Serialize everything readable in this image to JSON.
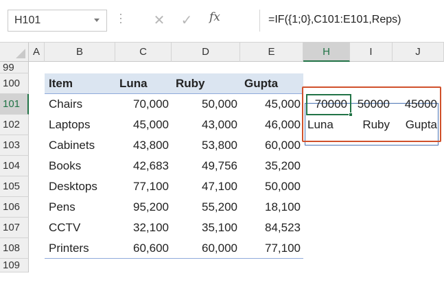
{
  "name_box": "H101",
  "formula_bar": {
    "cancel_icon": "✕",
    "enter_icon": "✓",
    "fx_label": "fx",
    "formula": "=IF({1;0},C101:E101,Reps)"
  },
  "columns": [
    "A",
    "B",
    "C",
    "D",
    "E",
    "H",
    "I",
    "J"
  ],
  "rows": [
    "99",
    "100",
    "101",
    "102",
    "103",
    "104",
    "105",
    "106",
    "107",
    "108",
    "109"
  ],
  "table": {
    "headers": [
      "Item",
      "Luna",
      "Ruby",
      "Gupta"
    ],
    "data": [
      [
        "Chairs",
        "70,000",
        "50,000",
        "45,000"
      ],
      [
        "Laptops",
        "45,000",
        "43,000",
        "46,000"
      ],
      [
        "Cabinets",
        "43,800",
        "53,800",
        "60,000"
      ],
      [
        "Books",
        "42,683",
        "49,756",
        "35,200"
      ],
      [
        "Desktops",
        "77,100",
        "47,100",
        "50,000"
      ],
      [
        "Pens",
        "95,200",
        "55,200",
        "18,100"
      ],
      [
        "CCTV",
        "32,100",
        "35,100",
        "84,523"
      ],
      [
        "Printers",
        "60,600",
        "60,000",
        "77,100"
      ]
    ]
  },
  "result": {
    "row1": [
      "70000",
      "50000",
      "45000"
    ],
    "row2": [
      "Luna",
      "Ruby",
      "Gupta"
    ]
  },
  "colors": {
    "excel_green": "#217346",
    "annotation_orange": "#d0502a",
    "table_header_bg": "#dbe5f1",
    "table_band": "#8eaadb"
  }
}
